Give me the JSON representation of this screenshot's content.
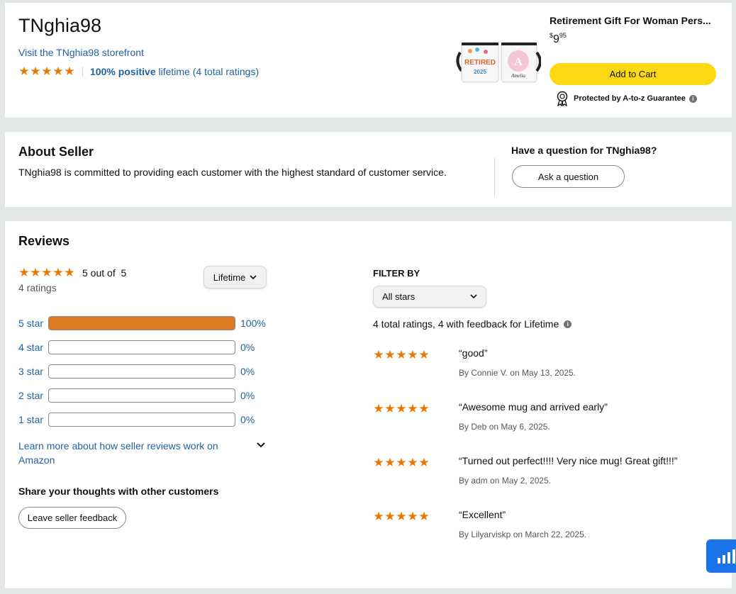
{
  "seller": {
    "name": "TNghia98",
    "storefront_link": "Visit the TNghia98 storefront",
    "positive_pct": "100% positive",
    "lifetime_ratings": "lifetime (4 total ratings)",
    "rating_stars": 5
  },
  "product": {
    "title": "Retirement Gift For Woman Pers...",
    "price_currency": "$",
    "price_whole": "9",
    "price_fraction": "95",
    "add_to_cart": "Add to Cart",
    "guarantee": "Protected by A-to-z Guarantee",
    "mug_text_left": "RETIRED",
    "mug_year": "2025",
    "mug_initial": "A",
    "mug_name": "Amelia"
  },
  "about": {
    "title": "About Seller",
    "text": "TNghia98 is committed to providing each customer with the highest standard of customer service.",
    "question_title": "Have a question for TNghia98?",
    "ask_button": "Ask a question"
  },
  "reviews": {
    "title": "Reviews",
    "summary_stars": 5,
    "summary_text": "5 out of  5",
    "ratings_count": "4 ratings",
    "period_select": "Lifetime",
    "histogram": [
      {
        "label": "5 star",
        "fraction": 1.0,
        "pct": "100%"
      },
      {
        "label": "4 star",
        "fraction": 0.0,
        "pct": "0%"
      },
      {
        "label": "3 star",
        "fraction": 0.0,
        "pct": "0%"
      },
      {
        "label": "2 star",
        "fraction": 0.0,
        "pct": "0%"
      },
      {
        "label": "1 star",
        "fraction": 0.0,
        "pct": "0%"
      }
    ],
    "learn_more": "Learn more about how seller reviews work on Amazon",
    "share_title": "Share your thoughts with other customers",
    "leave_feedback": "Leave seller feedback",
    "filter_title": "FILTER BY",
    "filter_select": "All stars",
    "filter_info": "4 total ratings, 4 with feedback for Lifetime",
    "items": [
      {
        "stars": 5,
        "text": "good",
        "by_prefix": "By ",
        "author": "Connie V.",
        "date": " on May 13, 2025."
      },
      {
        "stars": 5,
        "text": "Awesome mug and arrived early",
        "by_prefix": "By ",
        "author": "Deb",
        "date": " on May 6, 2025."
      },
      {
        "stars": 5,
        "text": "Turned out perfect!!!! Very nice mug! Great gift!!!",
        "by_prefix": "By ",
        "author": "adm",
        "date": " on May 2, 2025."
      },
      {
        "stars": 5,
        "text": "Excellent",
        "by_prefix": "By ",
        "author": "Lilyarviskp",
        "date": " on March 22, 2025."
      }
    ]
  },
  "colors": {
    "star": "#e67a00",
    "bar_fill": "#de7921",
    "link": "#2162a1",
    "cart_button": "#ffd814",
    "chat_widget": "#1a73e8"
  },
  "icons": {
    "star": "★",
    "chevron": "chevron-down-icon",
    "info": "info-icon",
    "badge": "award-ribbon-icon",
    "chat": "chat-widget-icon"
  }
}
